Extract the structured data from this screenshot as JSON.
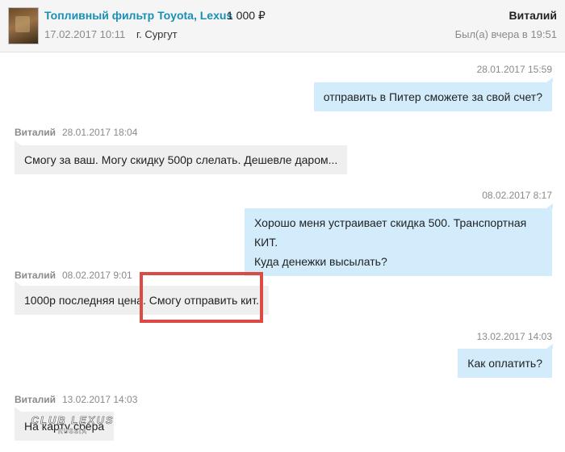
{
  "header": {
    "product_title": "Топливный фильтр Toyota, Lexus",
    "price": "1 000 ₽",
    "listing_date": "17.02.2017 10:11",
    "city": "г. Сургут",
    "user_name": "Виталий",
    "last_seen": "Был(а) вчера в 19:51"
  },
  "messages": [
    {
      "direction": "out",
      "author": "",
      "time": "28.01.2017 15:59",
      "lines": [
        "отправить в Питер сможете за свой счет?"
      ]
    },
    {
      "direction": "in",
      "author": "Виталий",
      "time": "28.01.2017 18:04",
      "lines": [
        "Смогу за ваш. Могу скидку 500р слелать. Дешевле даром..."
      ]
    },
    {
      "direction": "out",
      "author": "",
      "time": "08.02.2017 8:17",
      "lines": [
        "Хорошо меня устраивает скидка 500. Транспортная КИТ.",
        "Куда денежки высылать?"
      ]
    },
    {
      "direction": "in",
      "author": "Виталий",
      "time": "08.02.2017 9:01",
      "lines": [
        "1000р последняя цена. Смогу отправить кит."
      ]
    },
    {
      "direction": "out",
      "author": "",
      "time": "13.02.2017 14:03",
      "lines": [
        "Как оплатить?"
      ]
    },
    {
      "direction": "in",
      "author": "Виталий",
      "time": "13.02.2017 14:03",
      "lines": [
        "На карту сбера"
      ]
    }
  ],
  "watermark": {
    "line1": "CLUB LEXUS",
    "line2": "RUSSIA"
  },
  "colors": {
    "link": "#1a8fb4",
    "outgoing_bubble": "#d3ecfb",
    "incoming_bubble": "#efefef",
    "highlight": "#dd4a43"
  }
}
